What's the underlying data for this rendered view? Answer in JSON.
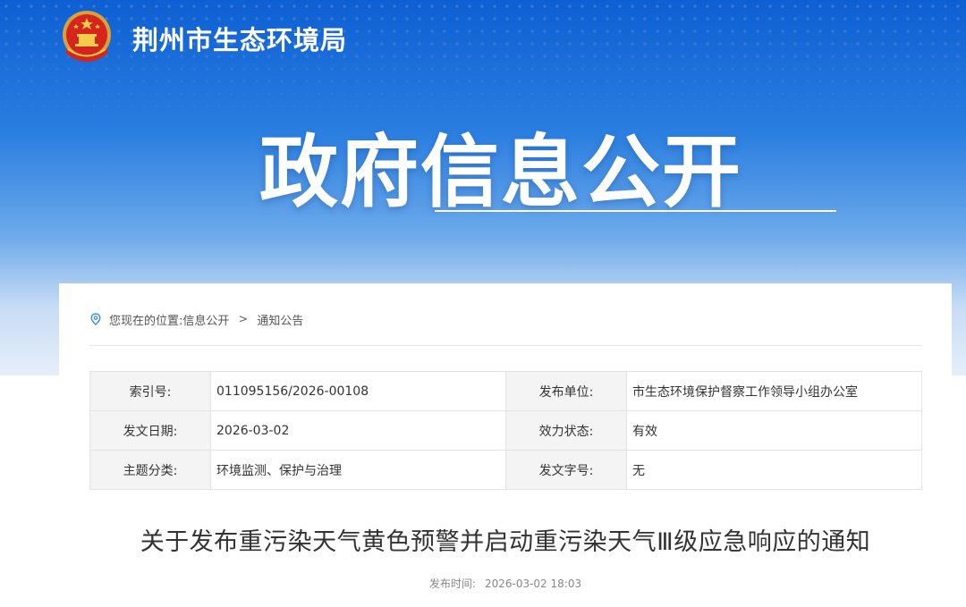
{
  "header": {
    "site_name": "荆州市生态环境局",
    "banner_title": "政府信息公开",
    "emblem_icon": "national-emblem-icon"
  },
  "breadcrumb": {
    "prefix": "您现在的位置:",
    "items": [
      "信息公开",
      "通知公告"
    ],
    "separator": ">",
    "icon": "location-pin-icon"
  },
  "meta": {
    "rows": [
      {
        "k1": "索引号:",
        "v1": "011095156/2026-00108",
        "k2": "发布单位:",
        "v2": "市生态环境保护督察工作领导小组办公室"
      },
      {
        "k1": "发文日期:",
        "v1": "2026-03-02",
        "k2": "效力状态:",
        "v2": "有效"
      },
      {
        "k1": "主题分类:",
        "v1": "环境监测、保护与治理",
        "k2": "发文字号:",
        "v2": "无"
      }
    ]
  },
  "article": {
    "title": "关于发布重污染天气黄色预警并启动重污染天气Ⅲ级应急响应的通知",
    "publish_label": "发布时间:",
    "publish_time": "2026-03-02 18:03"
  },
  "colors": {
    "banner_top": "#0e5fd2",
    "banner_bottom": "#e6eef8",
    "accent": "#2a7ee0"
  }
}
